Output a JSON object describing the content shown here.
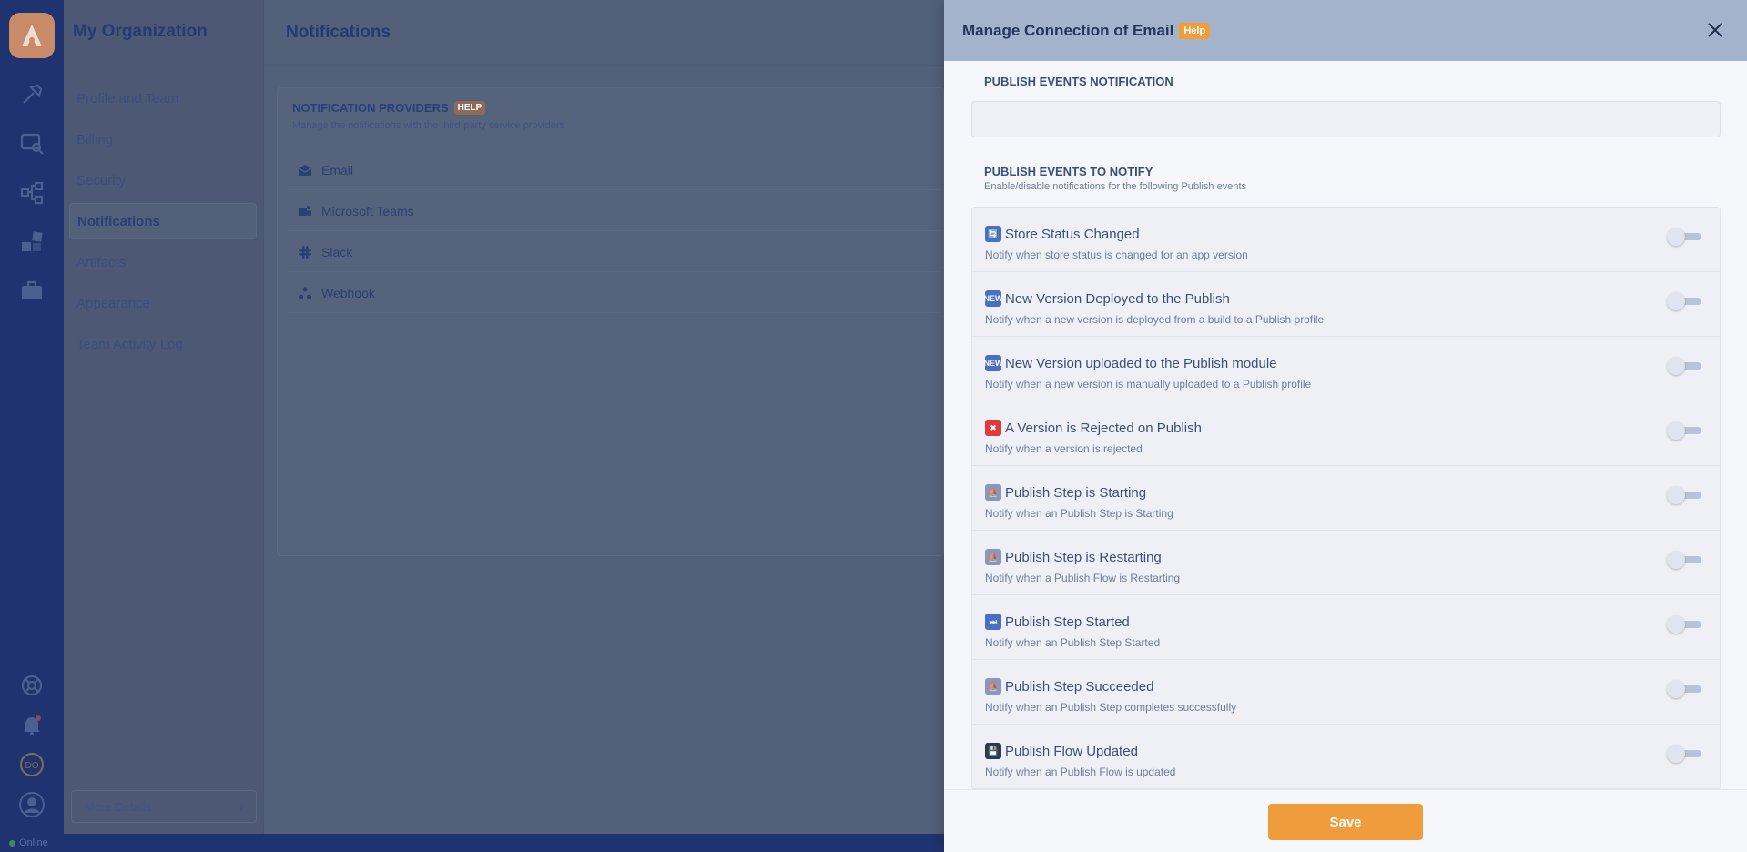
{
  "org": {
    "title": "My Organization",
    "nav": [
      {
        "label": "Profile and Team",
        "active": false
      },
      {
        "label": "Billing",
        "active": false
      },
      {
        "label": "Security",
        "active": false
      },
      {
        "label": "Notifications",
        "active": true
      },
      {
        "label": "Artifacts",
        "active": false
      },
      {
        "label": "Appearance",
        "active": false
      },
      {
        "label": "Team Activity Log",
        "active": false
      }
    ],
    "more_details": "More Details"
  },
  "main": {
    "page_title": "Notifications",
    "providers_title": "NOTIFICATION PROVIDERS",
    "providers_help": "HELP",
    "providers_sub": "Manage the notifications with the third-party service providers",
    "providers": [
      {
        "label": "Email",
        "icon": "mail-icon"
      },
      {
        "label": "Microsoft Teams",
        "icon": "teams-icon"
      },
      {
        "label": "Slack",
        "icon": "slack-icon"
      },
      {
        "label": "Webhook",
        "icon": "webhook-icon"
      }
    ]
  },
  "status": {
    "label": "Online"
  },
  "drawer": {
    "title": "Manage Connection of Email",
    "help": "Help",
    "section1_title": "PUBLISH EVENTS NOTIFICATION",
    "section2_title": "PUBLISH EVENTS TO NOTIFY",
    "section2_sub": "Enable/disable notifications for the following Publish events",
    "events": [
      {
        "title": "Store Status Changed",
        "desc": "Notify when store status is changed for an app version",
        "emoji": "🔄",
        "color": "#4a6fc4",
        "enabled": false
      },
      {
        "title": "New Version Deployed to the Publish",
        "desc": "Notify when a new version is deployed from a build to a Publish profile",
        "emoji": "NEW",
        "color": "#4a6fc4",
        "enabled": false
      },
      {
        "title": "New Version uploaded to the Publish module",
        "desc": "Notify when a new version is manually uploaded to a Publish profile",
        "emoji": "NEW",
        "color": "#4a6fc4",
        "enabled": false
      },
      {
        "title": "A Version is Rejected on Publish",
        "desc": "Notify when a version is rejected",
        "emoji": "✖",
        "color": "#e03a3a",
        "enabled": false
      },
      {
        "title": "Publish Step is Starting",
        "desc": "Notify when an Publish Step is Starting",
        "emoji": "⛵",
        "color": "#8a98b5",
        "enabled": false
      },
      {
        "title": "Publish Step is Restarting",
        "desc": "Notify when a Publish Flow is Restarting",
        "emoji": "⛵",
        "color": "#8a98b5",
        "enabled": false
      },
      {
        "title": "Publish Step Started",
        "desc": "Notify when an Publish Step Started",
        "emoji": "⏭",
        "color": "#4a6fc4",
        "enabled": false
      },
      {
        "title": "Publish Step Succeeded",
        "desc": "Notify when an Publish Step completes successfully",
        "emoji": "⛵",
        "color": "#8a98b5",
        "enabled": false
      },
      {
        "title": "Publish Flow Updated",
        "desc": "Notify when an Publish Flow is updated",
        "emoji": "💾",
        "color": "#2f3a4f",
        "enabled": false
      }
    ],
    "save_label": "Save"
  }
}
